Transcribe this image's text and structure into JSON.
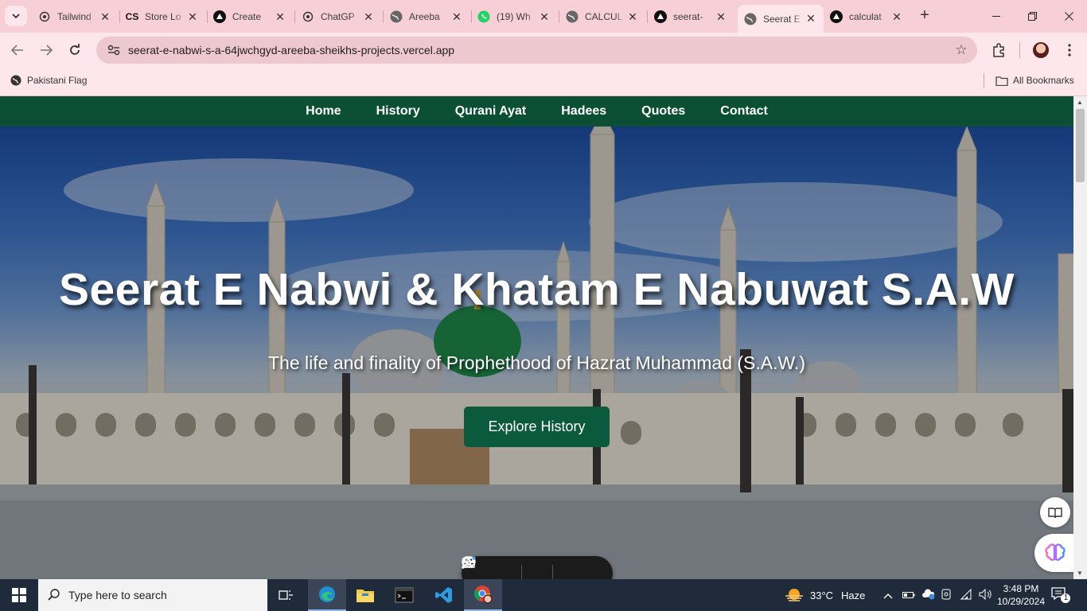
{
  "browser": {
    "tabs": [
      {
        "title": "Tailwind",
        "icon": "chatgpt-icon"
      },
      {
        "title": "Store Lo",
        "icon": "cs-icon",
        "icon_text": "CS"
      },
      {
        "title": "Create",
        "icon": "vercel-icon"
      },
      {
        "title": "ChatGP",
        "icon": "chatgpt-icon"
      },
      {
        "title": "Areeba",
        "icon": "globe-icon"
      },
      {
        "title": "(19) Wh",
        "icon": "whatsapp-icon"
      },
      {
        "title": "CALCUL",
        "icon": "globe-icon"
      },
      {
        "title": "seerat-",
        "icon": "vercel-icon"
      },
      {
        "title": "Seerat E",
        "icon": "globe-icon",
        "active": true
      },
      {
        "title": "calculat",
        "icon": "vercel-icon"
      }
    ],
    "url": "seerat-e-nabwi-s-a-64jwchgyd-areeba-sheikhs-projects.vercel.app",
    "bookmarks": {
      "left": "Pakistani Flag",
      "right": "All Bookmarks"
    }
  },
  "site": {
    "nav": [
      "Home",
      "History",
      "Qurani Ayat",
      "Hadees",
      "Quotes",
      "Contact"
    ],
    "hero": {
      "title": "Seerat E Nabwi & Khatam E Nabuwat S.A.W",
      "subtitle": "The life and finality of Prophethood of Hazrat Muhammad (S.A.W.)",
      "button": "Explore History"
    },
    "colors": {
      "nav_bg": "#0b4f34",
      "button_bg": "#0b5a3e"
    }
  },
  "taskbar": {
    "search_placeholder": "Type here to search",
    "weather": {
      "temp": "33°C",
      "condition": "Haze"
    },
    "time": "3:48 PM",
    "date": "10/29/2024",
    "notifications": "1"
  }
}
